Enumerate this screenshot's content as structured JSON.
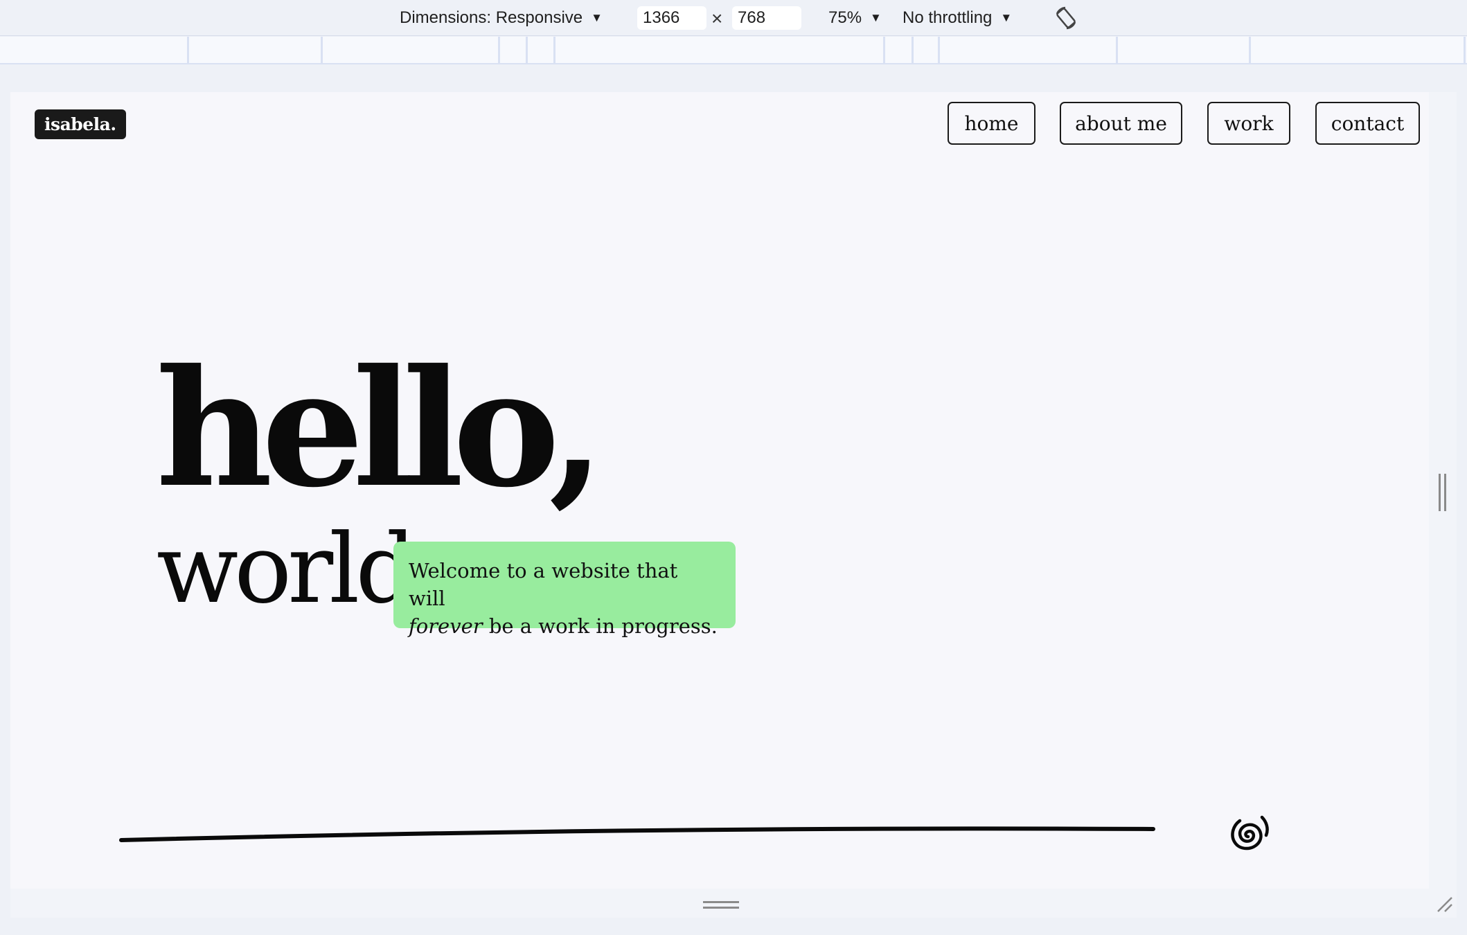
{
  "devtools": {
    "dimensions_label": "Dimensions: Responsive",
    "width_value": "1366",
    "times": "×",
    "height_value": "768",
    "zoom": "75%",
    "throttling": "No throttling",
    "caret": "▼"
  },
  "site": {
    "logo": "isabela.",
    "nav": [
      "home",
      "about me",
      "work",
      "contact"
    ],
    "hero_line1": "hello,",
    "hero_line2": "world.",
    "welcome_text_1": "Welcome to a website that will",
    "welcome_emphasis": "forever",
    "welcome_text_2": " be a work in progress."
  },
  "colors": {
    "welcome_bg": "#98ec9e",
    "logo_bg": "#1a1a1a",
    "page_bg": "#f7f7fb"
  },
  "icons": [
    "rotate-icon",
    "swirl-icon",
    "resize-grip-icon"
  ]
}
